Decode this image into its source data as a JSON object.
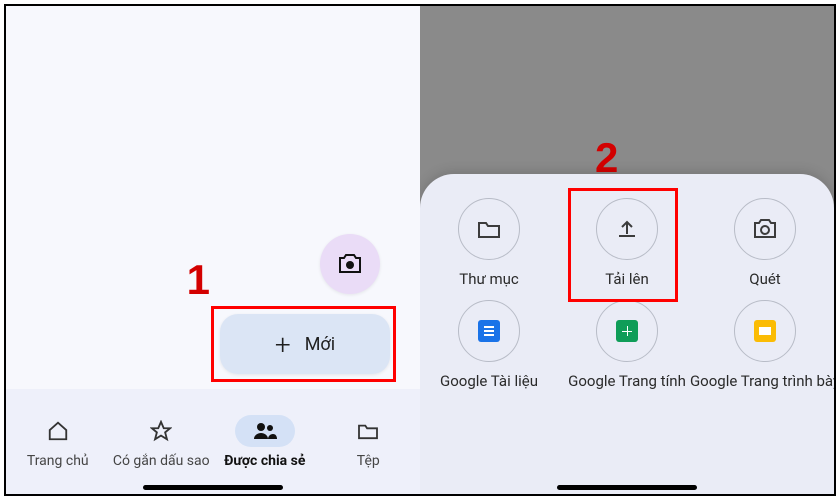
{
  "left": {
    "new_button": "Mới",
    "marker": "1",
    "nav": {
      "home": "Trang chủ",
      "starred": "Có gắn dấu sao",
      "shared": "Được chia sẻ",
      "files": "Tệp"
    }
  },
  "right": {
    "marker": "2",
    "actions": {
      "folder": "Thư mục",
      "upload": "Tải lên",
      "scan": "Quét",
      "docs": "Google Tài liệu",
      "sheets": "Google Trang tính",
      "slides": "Google Trang trình bày"
    }
  }
}
